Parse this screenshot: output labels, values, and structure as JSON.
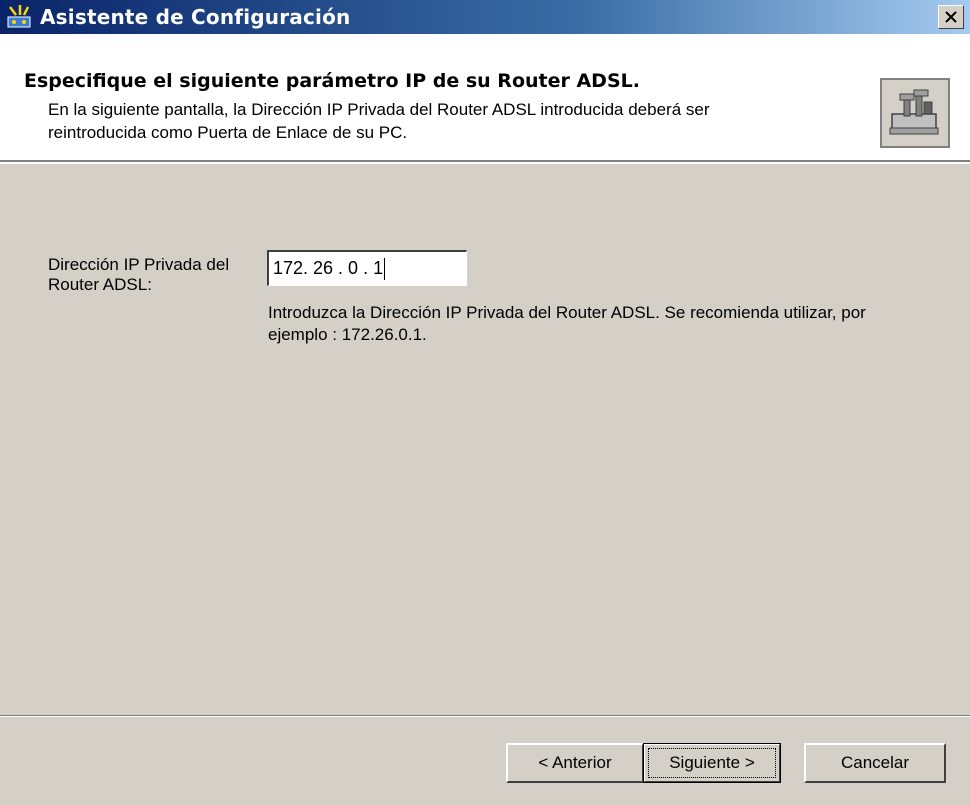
{
  "window": {
    "title": "Asistente de Configuración",
    "close_icon": "close-icon"
  },
  "header": {
    "title": "Especifique el siguiente parámetro IP de su Router ADSL.",
    "description": "En la siguiente pantalla, la Dirección IP Privada del Router ADSL introducida deberá ser reintroducida como Puerta de Enlace de su PC.",
    "icon": "router-icon"
  },
  "form": {
    "ip_label": "Dirección IP Privada del Router ADSL:",
    "ip_value": "172. 26 . 0 . 1",
    "hint": "Introduzca la Dirección IP Privada del Router ADSL. Se recomienda utilizar, por ejemplo : 172.26.0.1."
  },
  "buttons": {
    "back": "< Anterior",
    "next": "Siguiente >",
    "cancel": "Cancelar"
  },
  "colors": {
    "titlebar_start": "#0a246a",
    "titlebar_end": "#a6caf0",
    "dialog_bg": "#d4d0c8"
  }
}
